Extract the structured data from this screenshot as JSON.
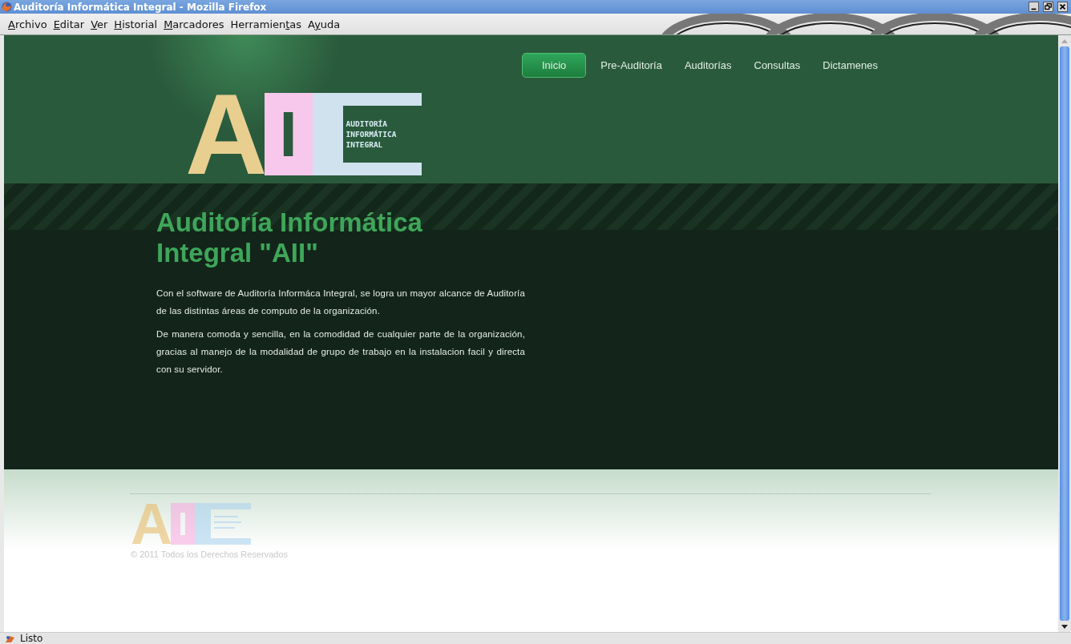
{
  "window": {
    "title": "Auditoría Informática Integral - Mozilla Firefox"
  },
  "menu": [
    {
      "key": "A",
      "after": "rchivo"
    },
    {
      "key": "E",
      "after": "ditar"
    },
    {
      "key": "V",
      "after": "er"
    },
    {
      "key": "H",
      "after": "istorial"
    },
    {
      "key": "M",
      "after": "arcadores"
    },
    {
      "before": "Herramien",
      "key": "t",
      "after": "as"
    },
    {
      "before": "A",
      "key": "y",
      "after": "uda"
    }
  ],
  "nav": [
    {
      "label": "Inicio",
      "selected": true
    },
    {
      "label": "Pre-Auditoría",
      "selected": false
    },
    {
      "label": "Auditorías",
      "selected": false
    },
    {
      "label": "Consultas",
      "selected": false
    },
    {
      "label": "Dictamenes",
      "selected": false
    }
  ],
  "logo": {
    "letters": [
      "A",
      "I"
    ],
    "tagline": [
      "AUDITORÍA",
      "INFORMÁTICA",
      "INTEGRAL"
    ]
  },
  "hero": {
    "heading": "Auditoría Informática Integral \"AII\"",
    "paragraphs": [
      "Con el software de Auditoría Informáca Integral, se logra un mayor alcance de Auditoría de las distintas áreas de computo de la organización.",
      "De manera comoda y sencilla, en la comodidad de cualquier parte de la organización, gracias al manejo de la modalidad de grupo de trabajo en la instalacion facil y directa con su servidor."
    ]
  },
  "footer": {
    "logo_letters": [
      "A",
      "I"
    ],
    "copyright": "© 2011 Todos los Derechos Reservados"
  },
  "status_bar": {
    "text": "Listo"
  }
}
